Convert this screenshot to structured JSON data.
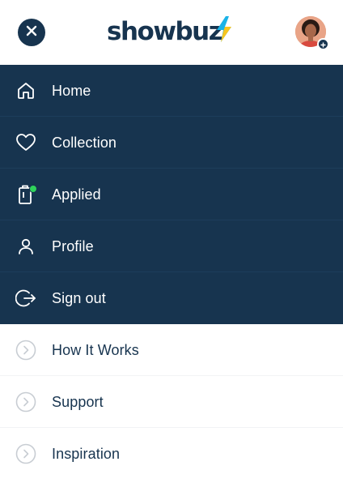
{
  "header": {
    "brand_name": "showbuz",
    "close_icon": "close-icon",
    "avatar_icon": "avatar",
    "avatar_badge_icon": "plus-icon"
  },
  "colors": {
    "navy": "#17344f",
    "bolt_blue": "#1ab3e8",
    "bolt_yellow": "#f7c51e",
    "badge_green": "#2fd35b"
  },
  "menu": {
    "primary": [
      {
        "label": "Home",
        "icon": "home-icon"
      },
      {
        "label": "Collection",
        "icon": "heart-icon"
      },
      {
        "label": "Applied",
        "icon": "clipboard-icon",
        "indicator": "green-dot"
      },
      {
        "label": "Profile",
        "icon": "user-icon"
      },
      {
        "label": "Sign out",
        "icon": "sign-out-icon"
      }
    ],
    "secondary": [
      {
        "label": "How It Works",
        "icon": "chevron-right-circle-icon"
      },
      {
        "label": "Support",
        "icon": "chevron-right-circle-icon"
      },
      {
        "label": "Inspiration",
        "icon": "chevron-right-circle-icon"
      }
    ]
  }
}
